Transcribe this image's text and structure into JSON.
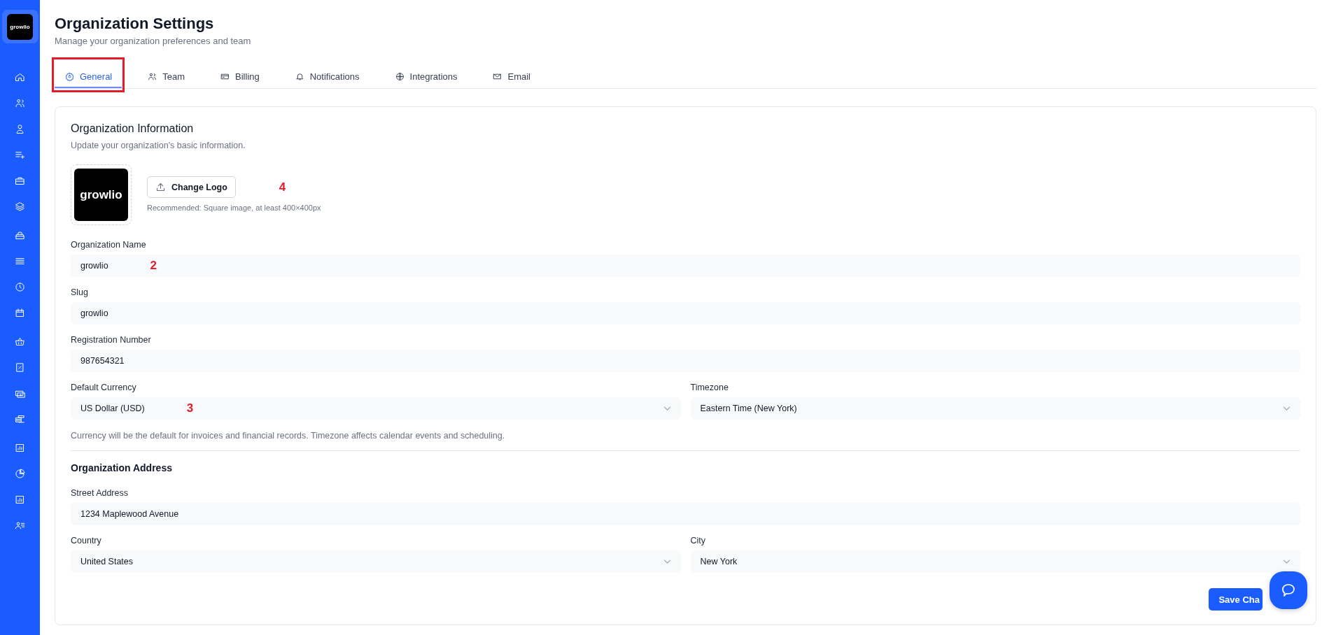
{
  "sidebar": {
    "logo": "growlio"
  },
  "header": {
    "title": "Organization Settings",
    "subtitle": "Manage your organization preferences and team"
  },
  "tabs": [
    {
      "label": "General",
      "selected": true,
      "annotated": true
    },
    {
      "label": "Team",
      "selected": false,
      "annotated": false
    },
    {
      "label": "Billing",
      "selected": false,
      "annotated": false
    },
    {
      "label": "Notifications",
      "selected": false,
      "annotated": false
    },
    {
      "label": "Integrations",
      "selected": false,
      "annotated": false
    },
    {
      "label": "Email",
      "selected": false,
      "annotated": false
    }
  ],
  "info": {
    "title": "Organization Information",
    "description": "Update your organization's basic information.",
    "logo": "growlio",
    "change_button": "Change Logo",
    "logo_marker": "4",
    "hint": "Recommended: Square image, at least 400×400px",
    "rows": [
      [
        {
          "label": "Organization Name",
          "kind": "text",
          "value": "growlio",
          "marker": "2"
        }
      ],
      [
        {
          "label": "Slug",
          "kind": "text",
          "value": "growlio"
        }
      ],
      [
        {
          "label": "Registration Number",
          "kind": "text",
          "value": "987654321"
        }
      ],
      [
        {
          "label": "Default Currency",
          "kind": "select",
          "value": "US Dollar (USD)",
          "marker": "3"
        },
        {
          "label": "Timezone",
          "kind": "select",
          "value": "Eastern Time (New York)"
        }
      ]
    ],
    "note": "Currency will be the default for invoices and financial records. Timezone affects calendar events and scheduling."
  },
  "address": {
    "title": "Organization Address",
    "rows": [
      [
        {
          "label": "Street Address",
          "kind": "text",
          "value": "1234 Maplewood Avenue"
        }
      ],
      [
        {
          "label": "Country",
          "kind": "select",
          "value": "United States"
        },
        {
          "label": "City",
          "kind": "select",
          "value": "New York"
        }
      ]
    ]
  },
  "save_button": "Save Cha"
}
